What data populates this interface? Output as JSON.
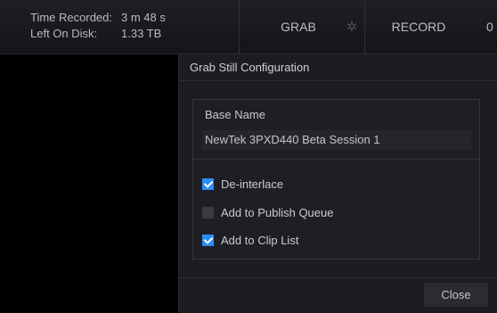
{
  "topbar": {
    "time_recorded_label": "Time Recorded:",
    "time_recorded_value": "3 m 48 s",
    "left_on_disk_label": "Left On Disk:",
    "left_on_disk_value": "1.33 TB",
    "grab_label": "GRAB",
    "settings_icon": "gear-icon",
    "record_label": "RECORD",
    "cut_text": "0"
  },
  "dialog": {
    "title": "Grab Still Configuration",
    "base_name_label": "Base Name",
    "base_name_value": "NewTek 3PXD440 Beta Session 1",
    "options": [
      {
        "label": "De-interlace",
        "checked": true
      },
      {
        "label": "Add to Publish Queue",
        "checked": false
      },
      {
        "label": "Add to Clip List",
        "checked": true
      }
    ],
    "close_label": "Close"
  },
  "colors": {
    "accent": "#2a8df4",
    "background": "#1c1d22"
  }
}
